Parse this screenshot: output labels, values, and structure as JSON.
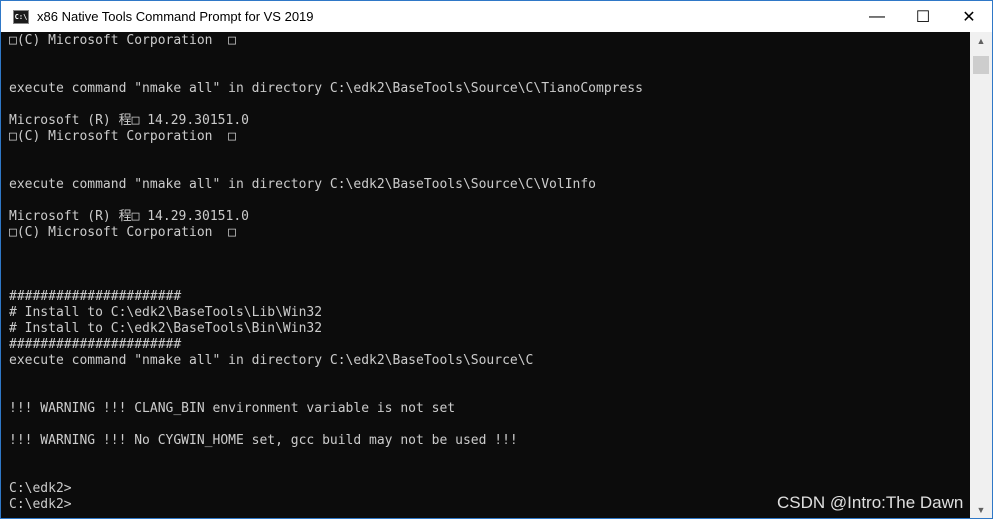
{
  "window": {
    "title": "x86 Native Tools Command Prompt for VS 2019",
    "icon_label": "C:\\",
    "controls": {
      "minimize": "—",
      "maximize": "☐",
      "close": "✕"
    }
  },
  "console": {
    "lines": [
      "□(C) Microsoft Corporation  □",
      "",
      "",
      "execute command \"nmake all\" in directory C:\\edk2\\BaseTools\\Source\\C\\TianoCompress",
      "",
      "Microsoft (R) 程□ 14.29.30151.0",
      "□(C) Microsoft Corporation  □",
      "",
      "",
      "execute command \"nmake all\" in directory C:\\edk2\\BaseTools\\Source\\C\\VolInfo",
      "",
      "Microsoft (R) 程□ 14.29.30151.0",
      "□(C) Microsoft Corporation  □",
      "",
      "",
      "",
      "######################",
      "# Install to C:\\edk2\\BaseTools\\Lib\\Win32",
      "# Install to C:\\edk2\\BaseTools\\Bin\\Win32",
      "######################",
      "execute command \"nmake all\" in directory C:\\edk2\\BaseTools\\Source\\C",
      "",
      "",
      "!!! WARNING !!! CLANG_BIN environment variable is not set",
      "",
      "!!! WARNING !!! No CYGWIN_HOME set, gcc build may not be used !!!",
      "",
      "",
      "C:\\edk2>",
      "C:\\edk2>"
    ]
  },
  "scrollbar": {
    "up_arrow": "▲",
    "down_arrow": "▼"
  },
  "watermark": "CSDN @Intro:The Dawn"
}
